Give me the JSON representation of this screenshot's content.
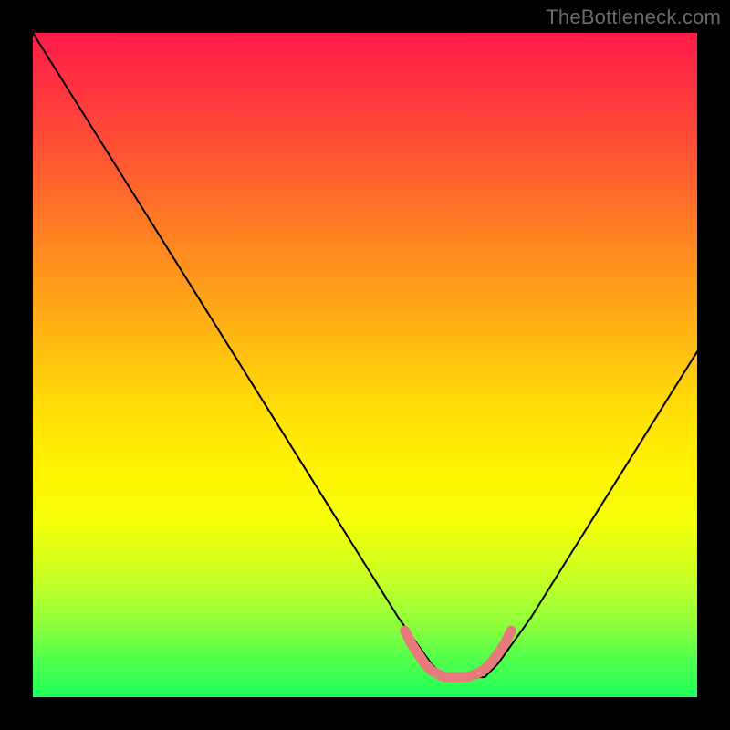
{
  "attribution": "TheBottleneck.com",
  "chart_data": {
    "type": "line",
    "title": "",
    "xlabel": "",
    "ylabel": "",
    "xlim": [
      0,
      100
    ],
    "ylim": [
      0,
      100
    ],
    "series": [
      {
        "name": "bottleneck-curve",
        "x": [
          0,
          5,
          10,
          15,
          20,
          25,
          30,
          35,
          40,
          45,
          50,
          55,
          60,
          62,
          65,
          68,
          70,
          75,
          80,
          85,
          90,
          95,
          100
        ],
        "values": [
          100,
          92,
          84,
          76,
          68,
          60,
          52,
          44,
          36,
          28,
          20,
          12,
          5,
          3,
          3,
          3,
          5,
          12,
          20,
          28,
          36,
          44,
          52
        ]
      },
      {
        "name": "sweet-spot-band",
        "x": [
          56,
          57,
          58,
          59,
          60,
          61,
          62,
          63,
          64,
          65,
          66,
          67,
          68,
          69,
          70,
          71,
          72
        ],
        "values": [
          10,
          8,
          6.5,
          5,
          4,
          3.5,
          3,
          3,
          3,
          3,
          3.2,
          3.6,
          4.2,
          5.2,
          6.5,
          8,
          10
        ]
      }
    ],
    "gradient_stops": [
      {
        "pos": 0,
        "color": "#ff1b4b"
      },
      {
        "pos": 8,
        "color": "#ff3340"
      },
      {
        "pos": 20,
        "color": "#ff5a30"
      },
      {
        "pos": 30,
        "color": "#ff7f22"
      },
      {
        "pos": 40,
        "color": "#ffa318"
      },
      {
        "pos": 50,
        "color": "#ffc60e"
      },
      {
        "pos": 58,
        "color": "#ffe106"
      },
      {
        "pos": 66,
        "color": "#fff402"
      },
      {
        "pos": 74,
        "color": "#f3ff08"
      },
      {
        "pos": 82,
        "color": "#c8ff24"
      },
      {
        "pos": 89,
        "color": "#8eff3a"
      },
      {
        "pos": 94,
        "color": "#55ff4c"
      },
      {
        "pos": 100,
        "color": "#1eff58"
      }
    ],
    "colors": {
      "curve": "#000000",
      "sweet_spot": "#e77a7a",
      "background_frame": "#000000"
    }
  }
}
